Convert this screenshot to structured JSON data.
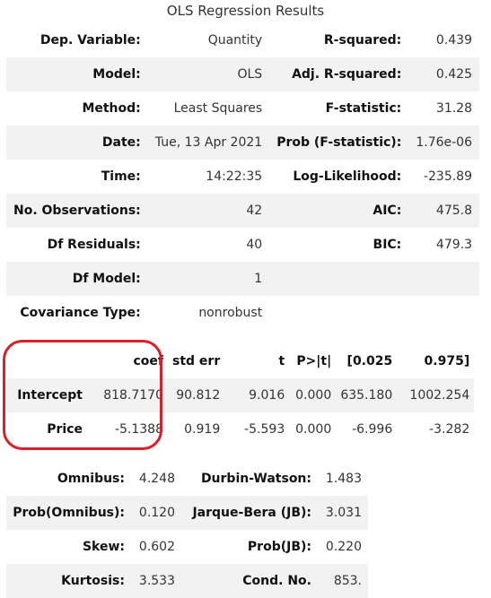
{
  "caption": "OLS Regression Results",
  "summary_rows": [
    {
      "k1": "Dep. Variable:",
      "v1": "Quantity",
      "k2": "R-squared:",
      "v2": "0.439"
    },
    {
      "k1": "Model:",
      "v1": "OLS",
      "k2": "Adj. R-squared:",
      "v2": "0.425"
    },
    {
      "k1": "Method:",
      "v1": "Least Squares",
      "k2": "F-statistic:",
      "v2": "31.28"
    },
    {
      "k1": "Date:",
      "v1": "Tue, 13 Apr 2021",
      "k2": "Prob (F-statistic):",
      "v2": "1.76e-06"
    },
    {
      "k1": "Time:",
      "v1": "14:22:35",
      "k2": "Log-Likelihood:",
      "v2": "-235.89"
    },
    {
      "k1": "No. Observations:",
      "v1": "42",
      "k2": "AIC:",
      "v2": "475.8"
    },
    {
      "k1": "Df Residuals:",
      "v1": "40",
      "k2": "BIC:",
      "v2": "479.3"
    },
    {
      "k1": "Df Model:",
      "v1": "1",
      "k2": "",
      "v2": ""
    },
    {
      "k1": "Covariance Type:",
      "v1": "nonrobust",
      "k2": "",
      "v2": ""
    }
  ],
  "coef_table": {
    "headers": [
      "",
      "coef",
      "std err",
      "t",
      "P>|t|",
      "[0.025",
      "0.975]"
    ],
    "rows": [
      {
        "name": "Intercept",
        "cells": [
          "818.7170",
          "90.812",
          "9.016",
          "0.000",
          "635.180",
          "1002.254"
        ]
      },
      {
        "name": "Price",
        "cells": [
          "-5.1388",
          "0.919",
          "-5.593",
          "0.000",
          "-6.996",
          "-3.282"
        ]
      }
    ]
  },
  "diagnostics_rows": [
    {
      "k1": "Omnibus:",
      "v1": "4.248",
      "k2": "Durbin-Watson:",
      "v2": "1.483"
    },
    {
      "k1": "Prob(Omnibus):",
      "v1": "0.120",
      "k2": "Jarque-Bera (JB):",
      "v2": "3.031"
    },
    {
      "k1": "Skew:",
      "v1": "0.602",
      "k2": "Prob(JB):",
      "v2": "0.220"
    },
    {
      "k1": "Kurtosis:",
      "v1": "3.533",
      "k2": "Cond. No.",
      "v2": "853."
    }
  ],
  "annotation": {
    "color": "#d9202a"
  }
}
